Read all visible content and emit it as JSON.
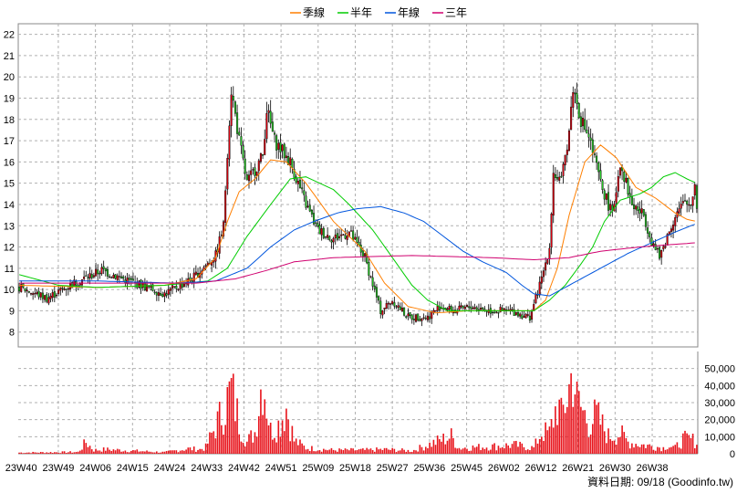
{
  "chart_data": {
    "type": "candlestick",
    "legend": [
      {
        "name": "季線",
        "color": "#ff7f00"
      },
      {
        "name": "半年",
        "color": "#00cc00"
      },
      {
        "name": "年線",
        "color": "#0055dd"
      },
      {
        "name": "三年",
        "color": "#d0006f"
      }
    ],
    "price_axis": {
      "min": 7.3,
      "max": 22.5,
      "ticks": [
        8,
        9,
        10,
        11,
        12,
        13,
        14,
        15,
        16,
        17,
        18,
        19,
        20,
        21,
        22
      ]
    },
    "volume_axis": {
      "min": 0,
      "max": 60000,
      "ticks": [
        0,
        10000,
        20000,
        30000,
        40000,
        50000
      ],
      "tick_labels": [
        "0",
        "10,000",
        "20,000",
        "30,000",
        "40,000",
        "50,000"
      ]
    },
    "x_labels": [
      "23W40",
      "23W49",
      "24W06",
      "24W15",
      "24W24",
      "24W33",
      "24W42",
      "24W51",
      "25W09",
      "25W18",
      "25W27",
      "25W36",
      "25W45",
      "26W02",
      "26W12",
      "26W21",
      "26W30",
      "26W38"
    ],
    "price_path": [
      [
        0,
        10.1
      ],
      [
        14,
        9.6
      ],
      [
        28,
        10.3
      ],
      [
        42,
        10.9
      ],
      [
        56,
        10.4
      ],
      [
        74,
        9.8
      ],
      [
        88,
        10.5
      ],
      [
        100,
        11.6
      ],
      [
        104,
        13.0
      ],
      [
        106,
        16.5
      ],
      [
        108,
        19.4
      ],
      [
        112,
        17.0
      ],
      [
        116,
        15.0
      ],
      [
        124,
        16.3
      ],
      [
        126,
        18.5
      ],
      [
        130,
        17.0
      ],
      [
        138,
        16.0
      ],
      [
        146,
        14.0
      ],
      [
        152,
        12.8
      ],
      [
        160,
        12.4
      ],
      [
        168,
        12.7
      ],
      [
        176,
        11.5
      ],
      [
        184,
        9.0
      ],
      [
        190,
        9.5
      ],
      [
        198,
        8.7
      ],
      [
        208,
        8.7
      ],
      [
        214,
        9.2
      ],
      [
        222,
        9.0
      ],
      [
        230,
        9.2
      ],
      [
        240,
        9.0
      ],
      [
        250,
        9.0
      ],
      [
        260,
        8.7
      ],
      [
        266,
        10.5
      ],
      [
        270,
        12.0
      ],
      [
        272,
        15.5
      ],
      [
        276,
        15.0
      ],
      [
        280,
        17.5
      ],
      [
        282,
        19.5
      ],
      [
        286,
        18.0
      ],
      [
        290,
        17.2
      ],
      [
        296,
        15.0
      ],
      [
        302,
        13.5
      ],
      [
        306,
        16.0
      ],
      [
        312,
        14.0
      ],
      [
        318,
        13.5
      ],
      [
        322,
        12.3
      ],
      [
        326,
        11.5
      ],
      [
        330,
        12.5
      ],
      [
        334,
        13.5
      ],
      [
        338,
        14.0
      ],
      [
        342,
        14.0
      ],
      [
        344,
        15.0
      ],
      [
        345,
        14.0
      ]
    ],
    "volume_path": [
      [
        0,
        800
      ],
      [
        30,
        1200
      ],
      [
        34,
        8000
      ],
      [
        38,
        2500
      ],
      [
        44,
        3000
      ],
      [
        74,
        1000
      ],
      [
        86,
        3500
      ],
      [
        92,
        3000
      ],
      [
        95,
        4500
      ],
      [
        100,
        19000
      ],
      [
        104,
        30000
      ],
      [
        108,
        44000
      ],
      [
        112,
        22000
      ],
      [
        116,
        8000
      ],
      [
        120,
        15000
      ],
      [
        124,
        55000
      ],
      [
        128,
        16000
      ],
      [
        132,
        20000
      ],
      [
        136,
        32000
      ],
      [
        140,
        9000
      ],
      [
        146,
        4000
      ],
      [
        160,
        2500
      ],
      [
        176,
        2500
      ],
      [
        186,
        3000
      ],
      [
        200,
        2000
      ],
      [
        220,
        12000
      ],
      [
        224,
        4000
      ],
      [
        240,
        5000
      ],
      [
        252,
        6000
      ],
      [
        262,
        4000
      ],
      [
        266,
        15000
      ],
      [
        270,
        14000
      ],
      [
        274,
        35000
      ],
      [
        276,
        25000
      ],
      [
        280,
        45000
      ],
      [
        282,
        58000
      ],
      [
        284,
        36000
      ],
      [
        290,
        22000
      ],
      [
        294,
        26000
      ],
      [
        300,
        12000
      ],
      [
        306,
        14000
      ],
      [
        310,
        8000
      ],
      [
        318,
        6000
      ],
      [
        324,
        5000
      ],
      [
        328,
        4000
      ],
      [
        330,
        6000
      ],
      [
        334,
        4000
      ],
      [
        338,
        10000
      ],
      [
        342,
        10000
      ],
      [
        345,
        8000
      ]
    ],
    "moving_averages": [
      {
        "name": "季線",
        "color": "#ff7f00",
        "width": 1,
        "path": [
          [
            0,
            10.2
          ],
          [
            40,
            10.1
          ],
          [
            74,
            10.2
          ],
          [
            90,
            10.5
          ],
          [
            100,
            11.5
          ],
          [
            106,
            13.2
          ],
          [
            112,
            14.6
          ],
          [
            120,
            15.2
          ],
          [
            128,
            16.1
          ],
          [
            136,
            16.0
          ],
          [
            146,
            15.0
          ],
          [
            160,
            13.2
          ],
          [
            176,
            11.8
          ],
          [
            186,
            10.3
          ],
          [
            198,
            9.2
          ],
          [
            212,
            8.9
          ],
          [
            228,
            9.0
          ],
          [
            244,
            9.0
          ],
          [
            256,
            9.0
          ],
          [
            262,
            9.0
          ],
          [
            268,
            9.5
          ],
          [
            274,
            11.0
          ],
          [
            280,
            13.5
          ],
          [
            288,
            16.0
          ],
          [
            296,
            16.8
          ],
          [
            304,
            16.2
          ],
          [
            314,
            14.8
          ],
          [
            324,
            14.3
          ],
          [
            334,
            13.6
          ],
          [
            340,
            13.3
          ],
          [
            345,
            13.2
          ]
        ]
      },
      {
        "name": "半年",
        "color": "#00cc00",
        "width": 1,
        "path": [
          [
            0,
            10.7
          ],
          [
            20,
            10.2
          ],
          [
            40,
            10.1
          ],
          [
            74,
            10.2
          ],
          [
            96,
            10.4
          ],
          [
            106,
            11.0
          ],
          [
            116,
            12.5
          ],
          [
            128,
            14.0
          ],
          [
            138,
            15.2
          ],
          [
            146,
            15.3
          ],
          [
            160,
            14.7
          ],
          [
            168,
            14.0
          ],
          [
            180,
            12.8
          ],
          [
            190,
            11.5
          ],
          [
            200,
            10.2
          ],
          [
            208,
            9.5
          ],
          [
            218,
            9.0
          ],
          [
            230,
            9.0
          ],
          [
            244,
            9.0
          ],
          [
            256,
            9.0
          ],
          [
            262,
            9.0
          ],
          [
            270,
            9.5
          ],
          [
            278,
            10.2
          ],
          [
            286,
            11.2
          ],
          [
            292,
            12.0
          ],
          [
            298,
            13.2
          ],
          [
            306,
            14.2
          ],
          [
            316,
            14.5
          ],
          [
            322,
            14.8
          ],
          [
            328,
            15.3
          ],
          [
            334,
            15.5
          ],
          [
            340,
            15.2
          ],
          [
            345,
            15.0
          ]
        ]
      },
      {
        "name": "年線",
        "color": "#0055dd",
        "width": 1,
        "path": [
          [
            0,
            10.4
          ],
          [
            40,
            10.4
          ],
          [
            80,
            10.3
          ],
          [
            100,
            10.4
          ],
          [
            116,
            11.0
          ],
          [
            128,
            12.0
          ],
          [
            140,
            12.8
          ],
          [
            150,
            13.2
          ],
          [
            162,
            13.6
          ],
          [
            172,
            13.8
          ],
          [
            184,
            13.9
          ],
          [
            196,
            13.6
          ],
          [
            206,
            13.2
          ],
          [
            216,
            12.5
          ],
          [
            226,
            11.8
          ],
          [
            236,
            11.3
          ],
          [
            248,
            10.8
          ],
          [
            256,
            10.2
          ],
          [
            262,
            9.8
          ],
          [
            270,
            9.7
          ],
          [
            282,
            10.3
          ],
          [
            296,
            11.0
          ],
          [
            310,
            11.7
          ],
          [
            322,
            12.2
          ],
          [
            334,
            12.7
          ],
          [
            342,
            13.0
          ],
          [
            345,
            13.1
          ]
        ]
      },
      {
        "name": "三年",
        "color": "#d0006f",
        "width": 1,
        "path": [
          [
            0,
            10.3
          ],
          [
            50,
            10.3
          ],
          [
            90,
            10.3
          ],
          [
            110,
            10.5
          ],
          [
            126,
            10.9
          ],
          [
            140,
            11.3
          ],
          [
            160,
            11.5
          ],
          [
            200,
            11.6
          ],
          [
            240,
            11.5
          ],
          [
            262,
            11.4
          ],
          [
            280,
            11.5
          ],
          [
            296,
            11.8
          ],
          [
            316,
            12.0
          ],
          [
            330,
            12.1
          ],
          [
            345,
            12.2
          ]
        ]
      }
    ]
  },
  "footer": {
    "text": "資料日期: 09/18  (Goodinfo.tw)"
  }
}
